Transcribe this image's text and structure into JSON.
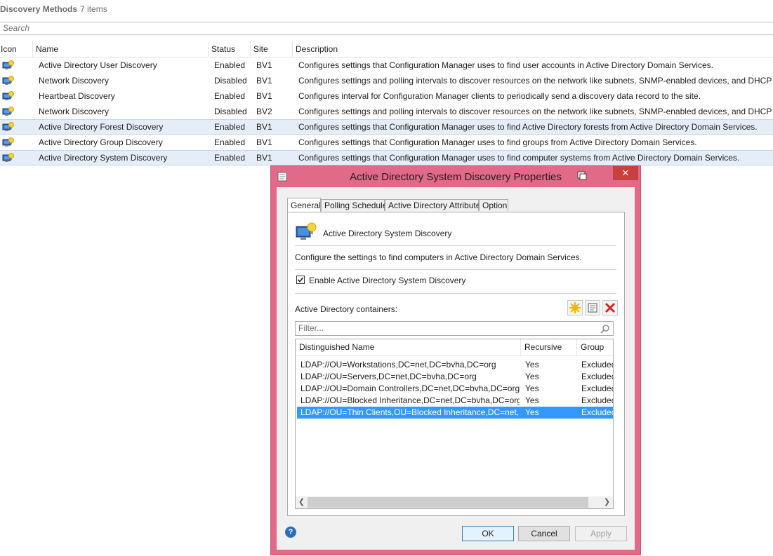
{
  "header": {
    "title": "Discovery Methods",
    "count": "7 items"
  },
  "search": {
    "placeholder": "Search"
  },
  "grid": {
    "columns": [
      "Icon",
      "Name",
      "Status",
      "Site",
      "Description"
    ],
    "rows": [
      {
        "name": "Active Directory User Discovery",
        "status": "Enabled",
        "site": "BV1",
        "description": "Configures settings that Configuration Manager uses to find user accounts in Active Directory Domain Services."
      },
      {
        "name": "Network Discovery",
        "status": "Disabled",
        "site": "BV1",
        "description": "Configures settings and polling intervals to discover resources on the network like subnets, SNMP-enabled devices, and DHCP cl"
      },
      {
        "name": "Heartbeat Discovery",
        "status": "Enabled",
        "site": "BV1",
        "description": "Configures interval for Configuration Manager clients to periodically send a discovery data record to the site."
      },
      {
        "name": "Network Discovery",
        "status": "Disabled",
        "site": "BV2",
        "description": "Configures settings and polling intervals to discover resources on the network like subnets, SNMP-enabled devices, and DHCP cl"
      },
      {
        "name": "Active Directory Forest Discovery",
        "status": "Enabled",
        "site": "BV1",
        "description": "Configures settings that Configuration Manager uses to find Active Directory forests from Active Directory Domain Services."
      },
      {
        "name": "Active Directory Group Discovery",
        "status": "Enabled",
        "site": "BV1",
        "description": "Configures settings that Configuration Manager uses to find groups from Active Directory Domain Services."
      },
      {
        "name": "Active Directory System Discovery",
        "status": "Enabled",
        "site": "BV1",
        "description": "Configures settings that Configuration Manager uses to find computer systems from Active Directory Domain Services."
      }
    ]
  },
  "dialog": {
    "title": "Active Directory System Discovery Properties",
    "close_label": "✕",
    "tabs": [
      "General",
      "Polling Schedule",
      "Active Directory Attributes",
      "Option"
    ],
    "heading": "Active Directory System Discovery",
    "description": "Configure the settings to find computers in Active Directory Domain Services.",
    "enable_label": "Enable Active Directory System Discovery",
    "enable_checked": true,
    "containers_label": "Active Directory containers:",
    "filter_placeholder": "Filter...",
    "list": {
      "columns": [
        "Distinguished Name",
        "Recursive",
        "Group"
      ],
      "rows": [
        {
          "dn": "LDAP://OU=Workstations,DC=net,DC=bvha,DC=org",
          "recursive": "Yes",
          "group": "Excluded"
        },
        {
          "dn": "LDAP://OU=Servers,DC=net,DC=bvha,DC=org",
          "recursive": "Yes",
          "group": "Excluded"
        },
        {
          "dn": "LDAP://OU=Domain Controllers,DC=net,DC=bvha,DC=org",
          "recursive": "Yes",
          "group": "Excluded"
        },
        {
          "dn": "LDAP://OU=Blocked Inheritance,DC=net,DC=bvha,DC=org",
          "recursive": "Yes",
          "group": "Excluded"
        },
        {
          "dn": "LDAP://OU=Thin Clients,OU=Blocked Inheritance,DC=net,DC=...",
          "recursive": "Yes",
          "group": "Excluded"
        }
      ]
    },
    "buttons": {
      "ok": "OK",
      "cancel": "Cancel",
      "apply": "Apply"
    },
    "help_label": "?"
  },
  "colors": {
    "dialog_frame": "#e06a88",
    "selection": "#3399ff",
    "close_button": "#c7403e"
  },
  "icons": [
    "discovery-method-icon",
    "properties-icon",
    "new-icon",
    "properties-small-icon",
    "delete-icon",
    "search-icon",
    "help-icon"
  ]
}
